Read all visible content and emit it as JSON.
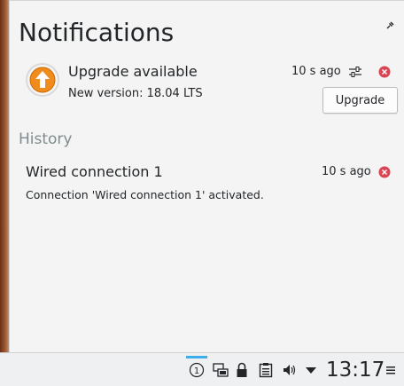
{
  "popup": {
    "title": "Notifications",
    "pin_icon": "pin-icon"
  },
  "notification": {
    "icon": "upgrade-arrow-icon",
    "title": "Upgrade available",
    "body": "New version: 18.04 LTS",
    "time": "10 s ago",
    "action_label": "Upgrade",
    "accent_color": "#f08c1e"
  },
  "history": {
    "heading": "History",
    "items": [
      {
        "title": "Wired connection 1",
        "time": "10 s ago",
        "body": "Connection 'Wired connection 1' activated."
      }
    ]
  },
  "panel": {
    "notification_count": "1",
    "clock": "13:17",
    "tray_icons": [
      "notifications-icon",
      "network-icon",
      "lock-icon",
      "clipboard-icon",
      "volume-icon",
      "expand-tray-icon",
      "menu-icon"
    ],
    "highlight_color": "#3daee9"
  },
  "colors": {
    "close_red": "#da4453",
    "text": "#232629",
    "muted": "#7f8c8d"
  }
}
